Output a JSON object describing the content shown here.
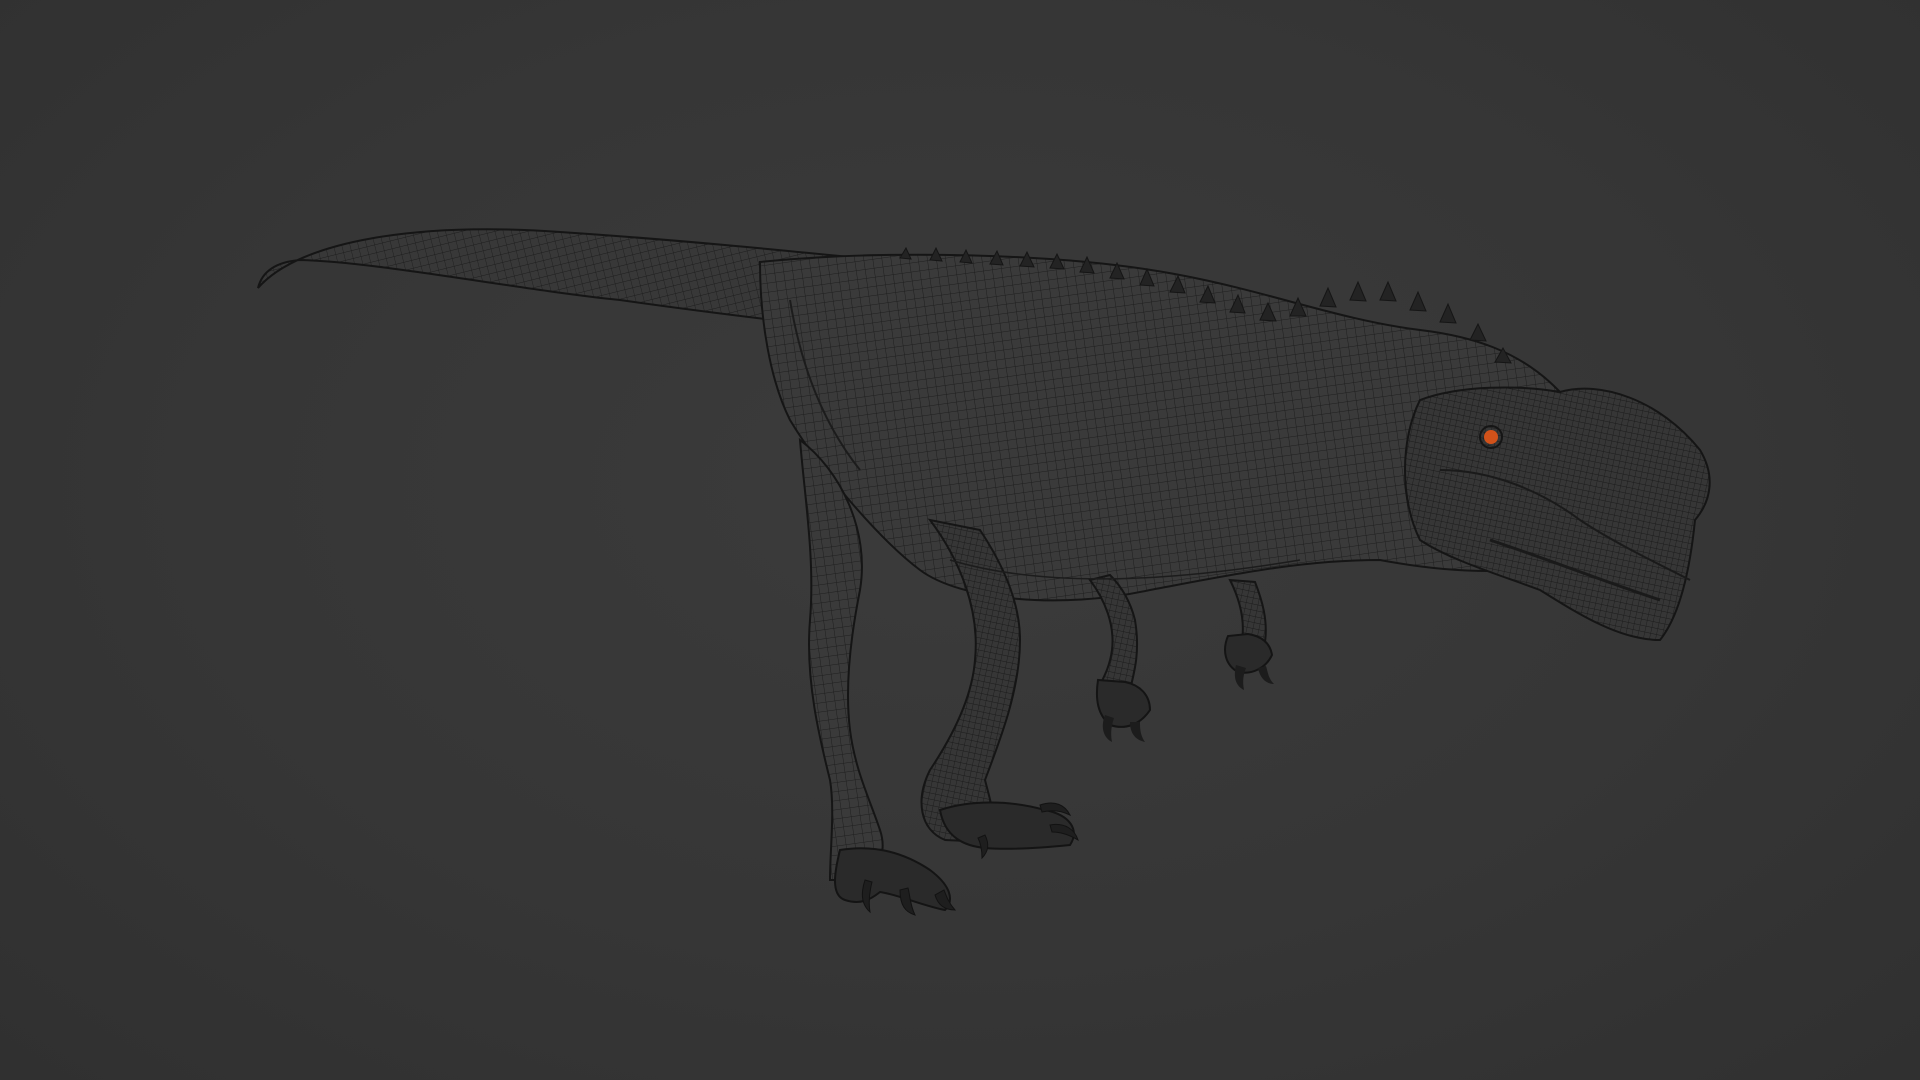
{
  "viewport": {
    "background_color": "#353535",
    "mode": "wireframe-on-shaded"
  },
  "model": {
    "subject": "theropod-dinosaur-mesh",
    "body_color": "#3a3a3a",
    "wire_color": "#1c1c1c",
    "edge_color": "#151515",
    "eye_color": "#d2521a"
  }
}
